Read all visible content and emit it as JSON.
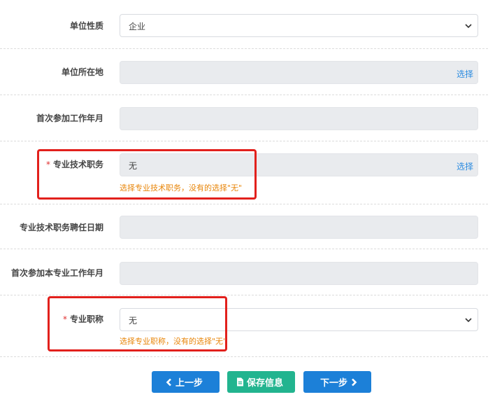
{
  "fields": {
    "unit_nature": {
      "label": "单位性质",
      "value": "企业"
    },
    "unit_location": {
      "label": "单位所在地",
      "action": "选择"
    },
    "first_work_date": {
      "label": "首次参加工作年月"
    },
    "prof_position": {
      "required_mark": "*",
      "label": "专业技术职务",
      "value": "无",
      "action": "选择",
      "hint": "选择专业技术职务，没有的选择\"无\""
    },
    "prof_position_date": {
      "label": "专业技术职务聘任日期"
    },
    "first_prof_work_date": {
      "label": "首次参加本专业工作年月"
    },
    "prof_title": {
      "required_mark": "*",
      "label": "专业职称",
      "value": "无",
      "hint": "选择专业职称，没有的选择\"无\""
    }
  },
  "buttons": {
    "prev": "上一步",
    "save": "保存信息",
    "next": "下一步"
  },
  "colors": {
    "primary": "#1c80d8",
    "success": "#22b48f",
    "hint": "#e8860a",
    "highlight": "#e2201c",
    "link": "#2b8be0"
  }
}
